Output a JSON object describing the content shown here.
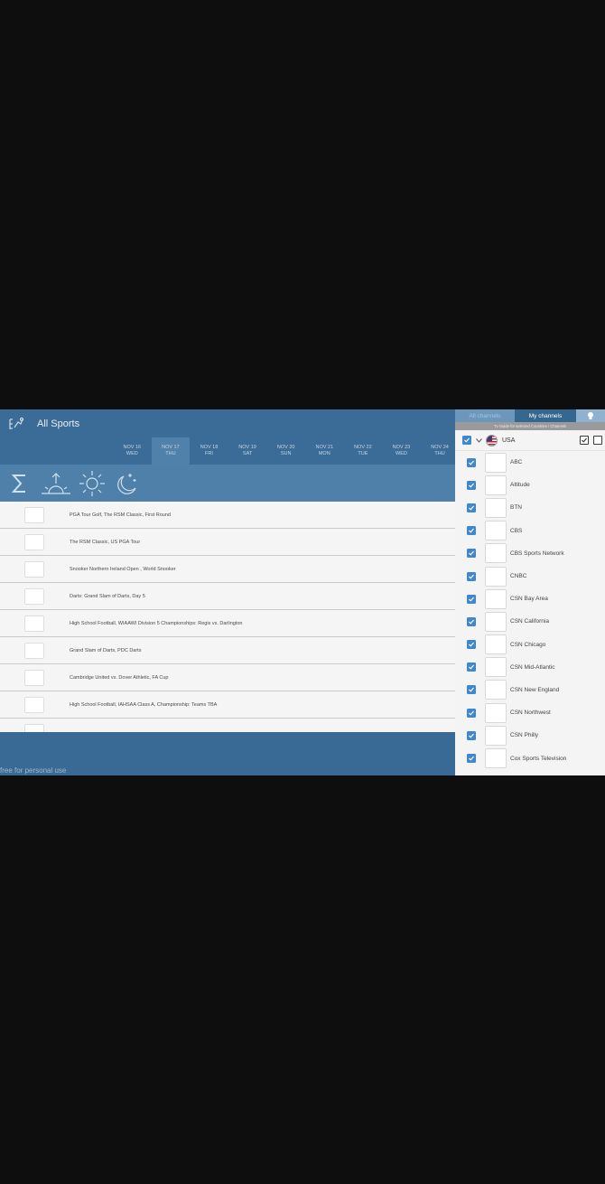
{
  "header": {
    "title": "All Sports",
    "logo_icon": "sports-logo-icon"
  },
  "dates": [
    {
      "date": "NOV 16",
      "day": "WED",
      "active": false
    },
    {
      "date": "NOV 17",
      "day": "THU",
      "active": true
    },
    {
      "date": "NOV 18",
      "day": "FRI",
      "active": false
    },
    {
      "date": "NOV 19",
      "day": "SAT",
      "active": false
    },
    {
      "date": "NOV 20",
      "day": "SUN",
      "active": false
    },
    {
      "date": "NOV 21",
      "day": "MON",
      "active": false
    },
    {
      "date": "NOV 22",
      "day": "TUE",
      "active": false
    },
    {
      "date": "NOV 23",
      "day": "WED",
      "active": false
    },
    {
      "date": "NOV 24",
      "day": "THU",
      "active": false
    }
  ],
  "filters": [
    "sum-icon",
    "sunrise-icon",
    "sun-icon",
    "moon-icon"
  ],
  "events": [
    {
      "title": "PGA Tour Golf, The RSM Classic, First Round",
      "logo": "GOLF",
      "logo_color": "#2a7a2a"
    },
    {
      "title": "The RSM Classic, US PGA Tour",
      "logo": "GOLF",
      "logo_color": "#b22222"
    },
    {
      "title": "Snooker Northern Ireland Open , World Snooker",
      "logo": "E1",
      "logo_color": "#1d3f8a"
    },
    {
      "title": "Darts: Grand Slam of Darts, Day 5",
      "logo": "FOX",
      "logo_color": "#1a4fa0"
    },
    {
      "title": "High School Football, WIAAWI Division 5 Championships: Regis vs. Darlington",
      "logo": "FSN",
      "logo_color": "#222"
    },
    {
      "title": "Grand Slam of Darts, PDC Darts",
      "logo": "SKY",
      "logo_color": "#c0142b"
    },
    {
      "title": "Cambridge United vs. Dover Athletic, FA Cup",
      "logo": "BBC",
      "logo_color": "#333"
    },
    {
      "title": "High School Football, IAHSAA Class A, Championship: Teams TBA",
      "logo": "CSN",
      "logo_color": "#555"
    },
    {
      "title": "",
      "logo": "ESPN",
      "logo_color": "#1a3a6a"
    }
  ],
  "footer": {
    "note": "free for personal use"
  },
  "panel": {
    "tab_all": "All channels",
    "tab_my": "My channels",
    "tab_info_icon": "bulb-icon",
    "note": "Tv Guide for selected Countries / Channels",
    "country": "USA",
    "channels": [
      {
        "name": "ABC",
        "logo": "abc",
        "logo_color": "#111"
      },
      {
        "name": "Altitude",
        "logo": "ALT",
        "logo_color": "#6a6a6a"
      },
      {
        "name": "BTN",
        "logo": "BTN",
        "logo_color": "#1a3f8a"
      },
      {
        "name": "CBS",
        "logo": "CBS",
        "logo_color": "#1a3f8a"
      },
      {
        "name": "CBS Sports Network",
        "logo": "CBSSN",
        "logo_color": "#1a3f8a"
      },
      {
        "name": "CNBC",
        "logo": "NBC",
        "logo_color": "#d32f2f"
      },
      {
        "name": "CSN Bay Area",
        "logo": "CSN",
        "logo_color": "#333"
      },
      {
        "name": "CSN California",
        "logo": "CSN",
        "logo_color": "#333"
      },
      {
        "name": "CSN Chicago",
        "logo": "CSN",
        "logo_color": "#333"
      },
      {
        "name": "CSN Mid-Atlantic",
        "logo": "CSN",
        "logo_color": "#333"
      },
      {
        "name": "CSN New England",
        "logo": "CSN",
        "logo_color": "#333"
      },
      {
        "name": "CSN Northwest",
        "logo": "CSN",
        "logo_color": "#333"
      },
      {
        "name": "CSN Philly",
        "logo": "CSN",
        "logo_color": "#333"
      },
      {
        "name": "Cox Sports Television",
        "logo": "CST",
        "logo_color": "#1a3f8a"
      }
    ]
  }
}
